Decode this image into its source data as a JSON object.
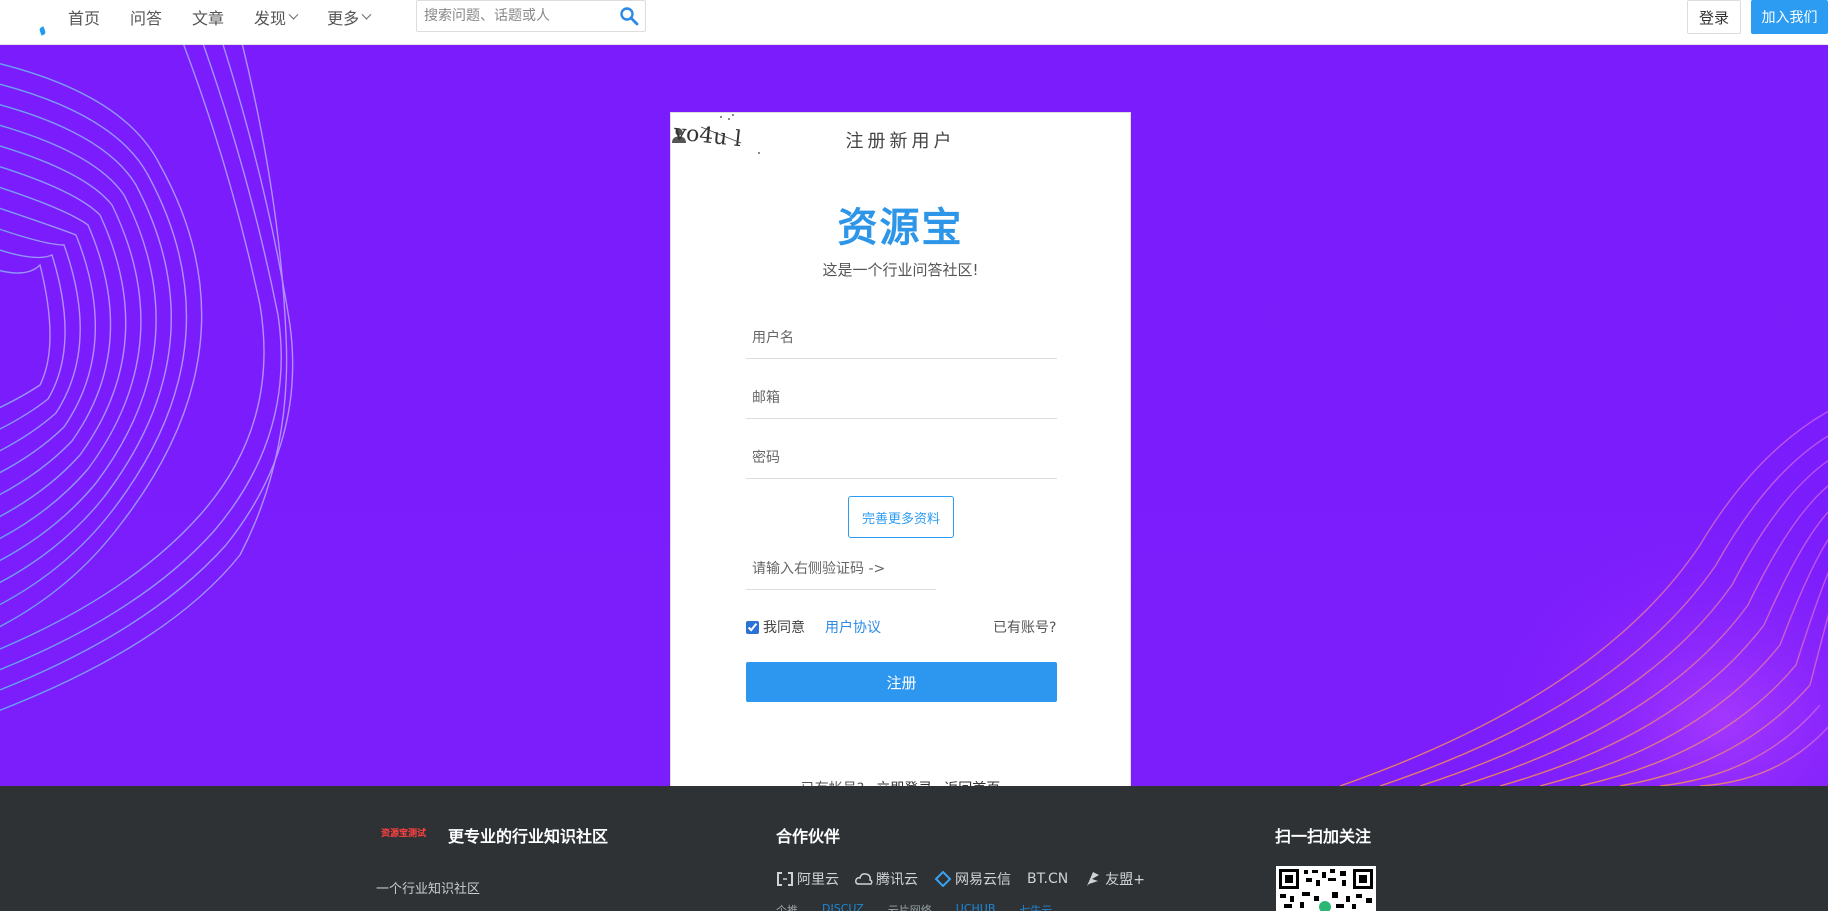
{
  "header": {
    "nav": [
      {
        "label": "首页",
        "dropdown": false
      },
      {
        "label": "问答",
        "dropdown": false
      },
      {
        "label": "文章",
        "dropdown": false
      },
      {
        "label": "发现",
        "dropdown": true
      },
      {
        "label": "更多",
        "dropdown": true
      }
    ],
    "search_placeholder": "搜索问题、话题或人",
    "login_label": "登录",
    "join_label": "加入我们"
  },
  "register": {
    "heading": "注册新用户",
    "brand": "资源宝",
    "subtitle": "这是一个行业问答社区!",
    "username_placeholder": "用户名",
    "email_placeholder": "邮箱",
    "password_placeholder": "密码",
    "more_info_label": "完善更多资料",
    "captcha_placeholder": "请输入右侧验证码 ->",
    "captcha_text": "vo4u l",
    "agree_label": "我同意",
    "agreement_link": "用户协议",
    "have_account": "已有账号?",
    "register_button": "注册",
    "footer_prefix": "已有帐号?",
    "login_now": "立即登录",
    "back_home": "返回首页"
  },
  "footer": {
    "logo_text": "资源宝测试",
    "tagline": "更专业的行业知识社区",
    "description": "一个行业知识社区",
    "partners_title": "合作伙伴",
    "partners": [
      "阿里云",
      "腾讯云",
      "网易云信",
      "BT.CN",
      "友盟+"
    ],
    "partners_row2": [
      "个推",
      "DISCUZ",
      "云片网络",
      "UCHUB",
      "七牛云"
    ],
    "qr_title": "扫一扫加关注"
  },
  "colors": {
    "accent": "#2b9cf2",
    "hero_bg": "#7b1cfc",
    "footer_bg": "#2e3235",
    "brand_text": "#2d96e8"
  }
}
